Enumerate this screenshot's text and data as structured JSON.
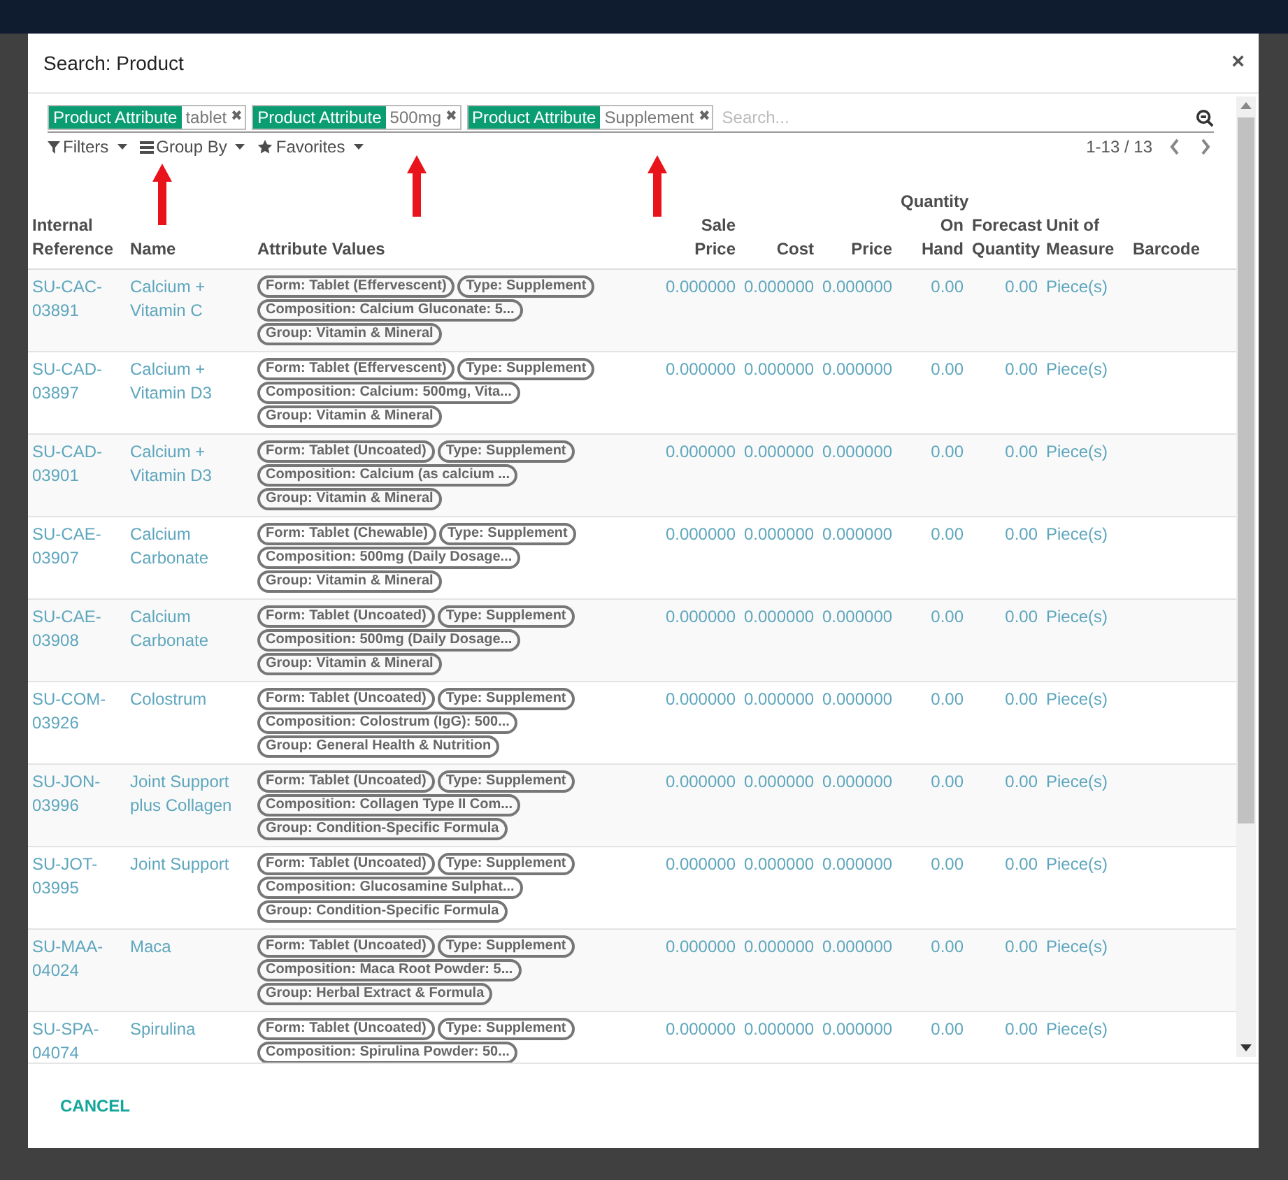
{
  "dialog": {
    "title": "Search: Product",
    "close": "×"
  },
  "search": {
    "facets": [
      {
        "field": "Product Attribute",
        "value": "tablet",
        "remove": "✖"
      },
      {
        "field": "Product Attribute",
        "value": "500mg",
        "remove": "✖"
      },
      {
        "field": "Product Attribute",
        "value": "Supplement",
        "remove": "✖"
      }
    ],
    "placeholder": "Search..."
  },
  "menus": [
    {
      "label": "Filters"
    },
    {
      "label": "Group By"
    },
    {
      "label": "Favorites"
    }
  ],
  "pager": {
    "range": "1-13 / 13"
  },
  "table": {
    "columns": [
      {
        "label": "Internal Reference"
      },
      {
        "label": "Name"
      },
      {
        "label": "Attribute Values"
      },
      {
        "label": "Sale Price"
      },
      {
        "label": "Cost"
      },
      {
        "label": "Price"
      },
      {
        "label": "Quantity On Hand"
      },
      {
        "label": "Forecast Quantity"
      },
      {
        "label": "Unit of Measure"
      },
      {
        "label": "Barcode"
      }
    ],
    "rows": [
      {
        "ref": "SU-CAC-03891",
        "name": "Calcium + Vitamin C",
        "tags": [
          "Form: Tablet (Effervescent)",
          "Type: Supplement",
          "Composition: Calcium Gluconate: 5...",
          "Group: Vitamin & Mineral"
        ],
        "sale_price": "0.000000",
        "cost": "0.000000",
        "price": "0.000000",
        "on_hand": "0.00",
        "forecast": "0.00",
        "uom": "Piece(s)"
      },
      {
        "ref": "SU-CAD-03897",
        "name": "Calcium + Vitamin D3",
        "tags": [
          "Form: Tablet (Effervescent)",
          "Type: Supplement",
          "Composition: Calcium: 500mg, Vita...",
          "Group: Vitamin & Mineral"
        ],
        "sale_price": "0.000000",
        "cost": "0.000000",
        "price": "0.000000",
        "on_hand": "0.00",
        "forecast": "0.00",
        "uom": "Piece(s)"
      },
      {
        "ref": "SU-CAD-03901",
        "name": "Calcium + Vitamin D3",
        "tags": [
          "Form: Tablet (Uncoated)",
          "Type: Supplement",
          "Composition: Calcium (as calcium ...",
          "Group: Vitamin & Mineral"
        ],
        "sale_price": "0.000000",
        "cost": "0.000000",
        "price": "0.000000",
        "on_hand": "0.00",
        "forecast": "0.00",
        "uom": "Piece(s)"
      },
      {
        "ref": "SU-CAE-03907",
        "name": "Calcium Carbonate",
        "tags": [
          "Form: Tablet (Chewable)",
          "Type: Supplement",
          "Composition: 500mg (Daily Dosage...",
          "Group: Vitamin & Mineral"
        ],
        "sale_price": "0.000000",
        "cost": "0.000000",
        "price": "0.000000",
        "on_hand": "0.00",
        "forecast": "0.00",
        "uom": "Piece(s)"
      },
      {
        "ref": "SU-CAE-03908",
        "name": "Calcium Carbonate",
        "tags": [
          "Form: Tablet (Uncoated)",
          "Type: Supplement",
          "Composition: 500mg (Daily Dosage...",
          "Group: Vitamin & Mineral"
        ],
        "sale_price": "0.000000",
        "cost": "0.000000",
        "price": "0.000000",
        "on_hand": "0.00",
        "forecast": "0.00",
        "uom": "Piece(s)"
      },
      {
        "ref": "SU-COM-03926",
        "name": "Colostrum",
        "tags": [
          "Form: Tablet (Uncoated)",
          "Type: Supplement",
          "Composition: Colostrum (IgG): 500...",
          "Group: General Health & Nutrition"
        ],
        "sale_price": "0.000000",
        "cost": "0.000000",
        "price": "0.000000",
        "on_hand": "0.00",
        "forecast": "0.00",
        "uom": "Piece(s)"
      },
      {
        "ref": "SU-JON-03996",
        "name": "Joint Support plus Collagen",
        "tags": [
          "Form: Tablet (Uncoated)",
          "Type: Supplement",
          "Composition: Collagen Type II Com...",
          "Group: Condition-Specific Formula"
        ],
        "sale_price": "0.000000",
        "cost": "0.000000",
        "price": "0.000000",
        "on_hand": "0.00",
        "forecast": "0.00",
        "uom": "Piece(s)"
      },
      {
        "ref": "SU-JOT-03995",
        "name": "Joint Support",
        "tags": [
          "Form: Tablet (Uncoated)",
          "Type: Supplement",
          "Composition: Glucosamine Sulphat...",
          "Group: Condition-Specific Formula"
        ],
        "sale_price": "0.000000",
        "cost": "0.000000",
        "price": "0.000000",
        "on_hand": "0.00",
        "forecast": "0.00",
        "uom": "Piece(s)"
      },
      {
        "ref": "SU-MAA-04024",
        "name": "Maca",
        "tags": [
          "Form: Tablet (Uncoated)",
          "Type: Supplement",
          "Composition: Maca Root Powder: 5...",
          "Group: Herbal Extract & Formula"
        ],
        "sale_price": "0.000000",
        "cost": "0.000000",
        "price": "0.000000",
        "on_hand": "0.00",
        "forecast": "0.00",
        "uom": "Piece(s)"
      },
      {
        "ref": "SU-SPA-04074",
        "name": "Spirulina",
        "tags": [
          "Form: Tablet (Uncoated)",
          "Type: Supplement",
          "Composition: Spirulina Powder: 50..."
        ],
        "sale_price": "0.000000",
        "cost": "0.000000",
        "price": "0.000000",
        "on_hand": "0.00",
        "forecast": "0.00",
        "uom": "Piece(s)"
      }
    ]
  },
  "footer": {
    "cancel": "CANCEL"
  }
}
